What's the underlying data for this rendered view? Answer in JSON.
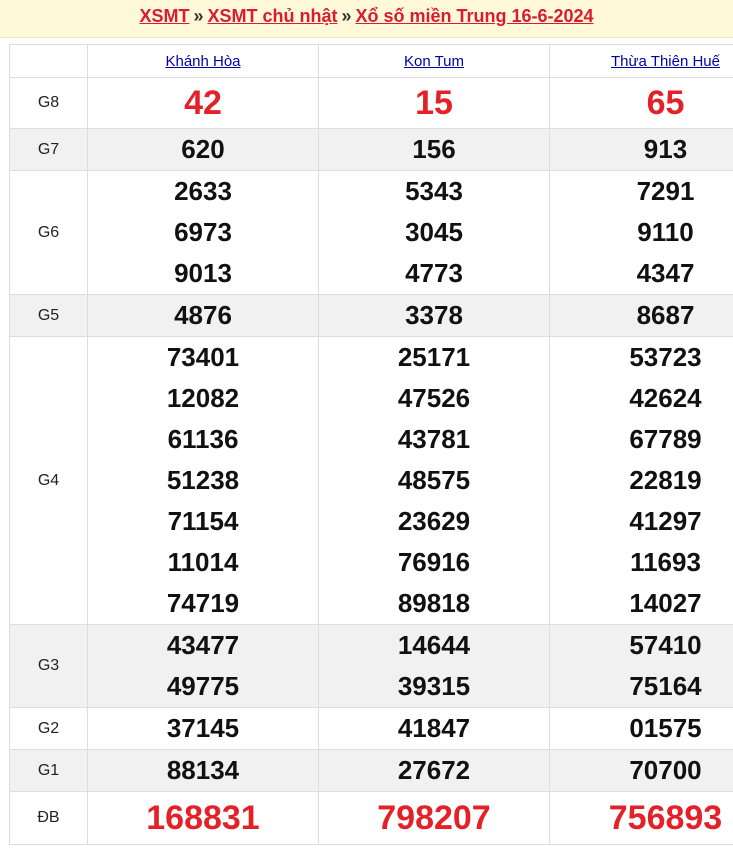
{
  "breadcrumb": {
    "home": "XSMT",
    "separator": "»",
    "weekday": "XSMT chủ nhật",
    "current": "Xổ số miền Trung 16-6-2024"
  },
  "provinces": [
    "Khánh Hòa",
    "Kon Tum",
    "Thừa Thiên Huế"
  ],
  "prizes": [
    {
      "label": "G8",
      "values": [
        [
          "42"
        ],
        [
          "15"
        ],
        [
          "65"
        ]
      ]
    },
    {
      "label": "G7",
      "values": [
        [
          "620"
        ],
        [
          "156"
        ],
        [
          "913"
        ]
      ]
    },
    {
      "label": "G6",
      "values": [
        [
          "2633",
          "6973",
          "9013"
        ],
        [
          "5343",
          "3045",
          "4773"
        ],
        [
          "7291",
          "9110",
          "4347"
        ]
      ]
    },
    {
      "label": "G5",
      "values": [
        [
          "4876"
        ],
        [
          "3378"
        ],
        [
          "8687"
        ]
      ]
    },
    {
      "label": "G4",
      "values": [
        [
          "73401",
          "12082",
          "61136",
          "51238",
          "71154",
          "11014",
          "74719"
        ],
        [
          "25171",
          "47526",
          "43781",
          "48575",
          "23629",
          "76916",
          "89818"
        ],
        [
          "53723",
          "42624",
          "67789",
          "22819",
          "41297",
          "11693",
          "14027"
        ]
      ]
    },
    {
      "label": "G3",
      "values": [
        [
          "43477",
          "49775"
        ],
        [
          "14644",
          "39315"
        ],
        [
          "57410",
          "75164"
        ]
      ]
    },
    {
      "label": "G2",
      "values": [
        [
          "37145"
        ],
        [
          "41847"
        ],
        [
          "01575"
        ]
      ]
    },
    {
      "label": "G1",
      "values": [
        [
          "88134"
        ],
        [
          "27672"
        ],
        [
          "70700"
        ]
      ]
    },
    {
      "label": "ĐB",
      "values": [
        [
          "168831"
        ],
        [
          "798207"
        ],
        [
          "756893"
        ]
      ]
    }
  ],
  "colors": {
    "breadcrumb_bg": "#fff8d9",
    "accent_red": "#e42128",
    "link_blue": "#0000a8",
    "alt_row": "#f1f1f1"
  }
}
